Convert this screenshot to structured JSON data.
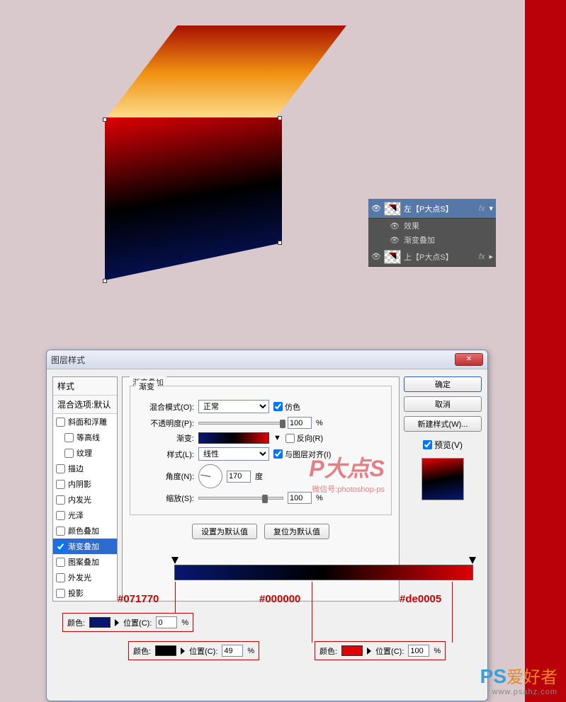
{
  "layers": {
    "row1": "左【P大点S】",
    "row2": "效果",
    "row3": "渐变叠加",
    "row4": "上【P大点S】",
    "fx": "fx"
  },
  "dialog": {
    "title": "图层样式",
    "styles_head": "样式",
    "blend_head": "混合选项:默认",
    "items": {
      "bevel": "斜面和浮雕",
      "contour": "等高线",
      "texture": "纹理",
      "stroke": "描边",
      "inner_shadow": "内阴影",
      "inner_glow": "内发光",
      "satin": "光泽",
      "color_overlay": "颜色叠加",
      "gradient_overlay": "渐变叠加",
      "pattern_overlay": "图案叠加",
      "outer_glow": "外发光",
      "drop_shadow": "投影"
    },
    "section": "渐变叠加",
    "sub": "渐变",
    "blend_mode": "混合模式(O):",
    "blend_val": "正常",
    "dither": "仿色",
    "opacity": "不透明度(P):",
    "opacity_val": "100",
    "pct": "%",
    "gradient": "渐变:",
    "reverse": "反向(R)",
    "style": "样式(L):",
    "style_val": "线性",
    "align": "与图层对齐(I)",
    "angle": "角度(N):",
    "angle_val": "170",
    "deg": "度",
    "scale": "缩放(S):",
    "scale_val": "100",
    "set_default": "设置为默认值",
    "reset_default": "复位为默认值",
    "ok": "确定",
    "cancel": "取消",
    "new_style": "新建样式(W)...",
    "preview": "预览(V)"
  },
  "hex": {
    "a": "#071770",
    "b": "#000000",
    "c": "#de0005"
  },
  "callout": {
    "color": "颜色:",
    "pos": "位置(C):",
    "p1": "0",
    "p2": "49",
    "p3": "100"
  },
  "wm": {
    "big": "P大点S",
    "small": "微信号:photoshop-ps"
  },
  "corner": {
    "logo1": "PS",
    "logo2": "爱好者",
    "url": "www.psahz.com"
  }
}
